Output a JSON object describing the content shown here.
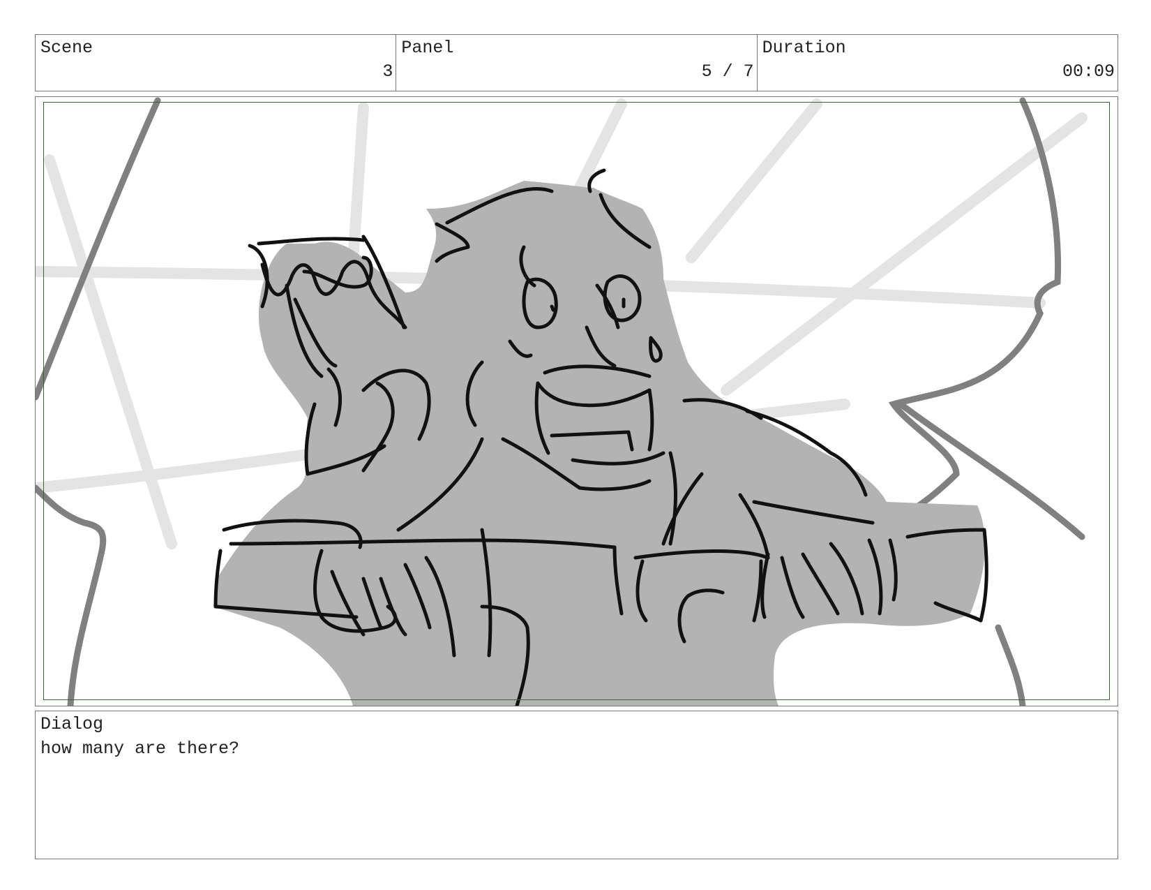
{
  "header": {
    "scene": {
      "label": "Scene",
      "value": "3"
    },
    "panel": {
      "label": "Panel",
      "value": "5 / 7"
    },
    "duration": {
      "label": "Duration",
      "value": "00:09"
    }
  },
  "dialog": {
    "label": "Dialog",
    "text": "how many are there?"
  },
  "colors": {
    "border": "#777777",
    "safe_frame": "#2e6b2e",
    "sketch_fill": "#b3b3b3",
    "sketch_line": "#111111",
    "background_line_light": "#e4e4e4",
    "background_line_dark": "#808080"
  }
}
